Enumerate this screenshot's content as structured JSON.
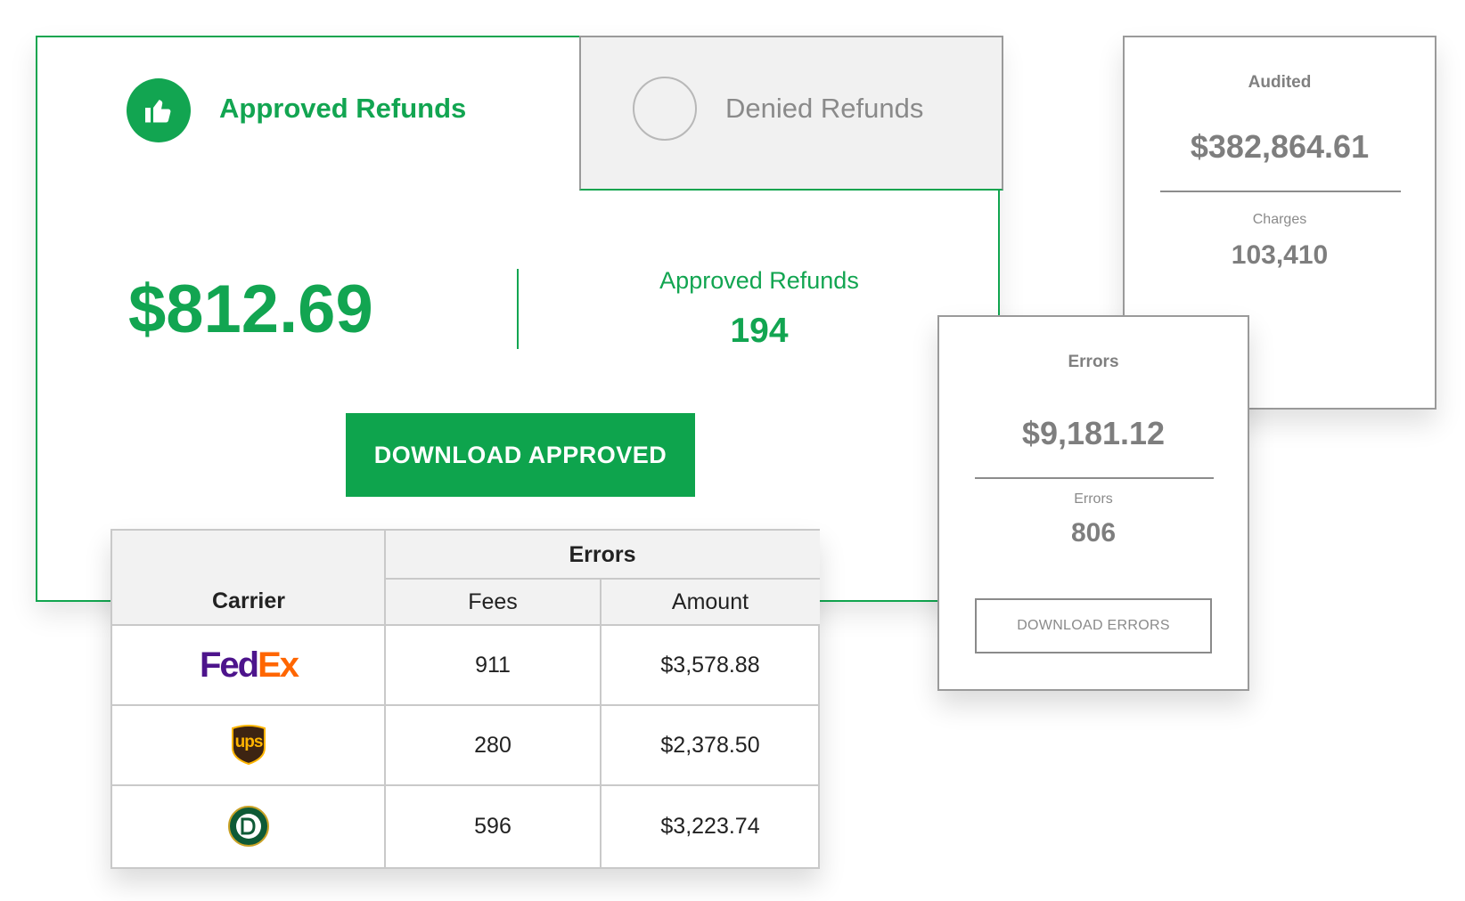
{
  "refunds": {
    "tabs": {
      "approved_label": "Approved Refunds",
      "denied_label": "Denied Refunds"
    },
    "total_amount": "$812.69",
    "count_label": "Approved Refunds",
    "count_value": "194",
    "download_button": "DOWNLOAD APPROVED",
    "approved_icon": "thumbs-up-icon",
    "accent_color": "#12a551"
  },
  "audited_card": {
    "title": "Audited",
    "amount": "$382,864.61",
    "sub_label": "Charges",
    "sub_value": "103,410"
  },
  "errors_card": {
    "title": "Errors",
    "amount": "$9,181.12",
    "sub_label": "Errors",
    "sub_value": "806",
    "download_button": "DOWNLOAD ERRORS"
  },
  "carrier_table": {
    "header_carrier": "Carrier",
    "header_group": "Errors",
    "header_fees": "Fees",
    "header_amount": "Amount",
    "rows": [
      {
        "carrier_logo": "fedex-logo",
        "fedex_left": "Fed",
        "fedex_right": "Ex",
        "fees": "911",
        "amount": "$3,578.88"
      },
      {
        "carrier_logo": "ups-logo",
        "ups_text": "ups",
        "fees": "280",
        "amount": "$2,378.50"
      },
      {
        "carrier_logo": "old-dominion-logo",
        "fees": "596",
        "amount": "$3,223.74"
      }
    ]
  }
}
